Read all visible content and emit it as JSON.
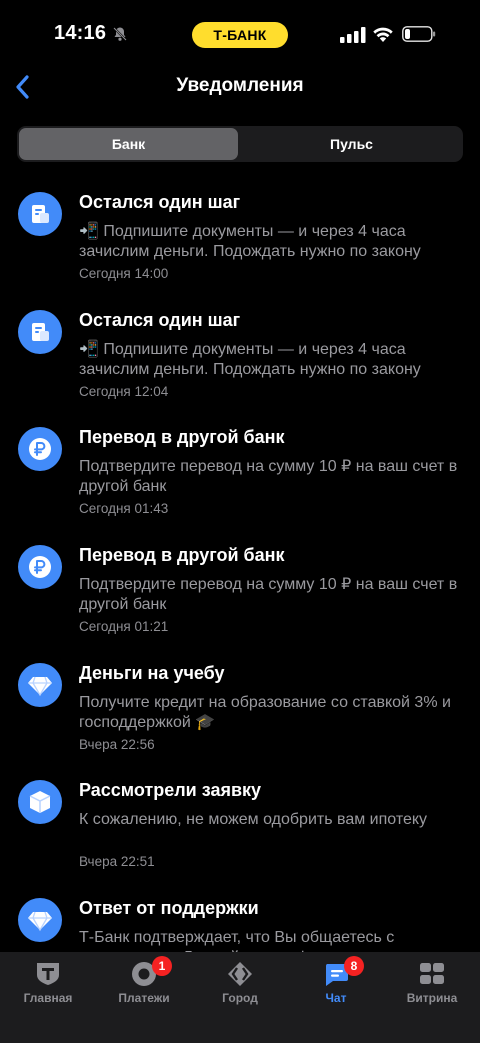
{
  "status_bar": {
    "time": "14:16",
    "brand": "Т-БАНК"
  },
  "header": {
    "title": "Уведомления"
  },
  "segments": [
    {
      "label": "Банк",
      "active": true
    },
    {
      "label": "Пульс",
      "active": false
    }
  ],
  "notifications": [
    {
      "icon": "document-icon",
      "title": "Остался один шаг",
      "body": "📲 Подпишите документы — и через 4 часа зачислим деньги. Подождать нужно по закону",
      "time": "Сегодня 14:00"
    },
    {
      "icon": "document-icon",
      "title": "Остался один шаг",
      "body": "📲 Подпишите документы — и через 4 часа зачислим деньги. Подождать нужно по закону",
      "time": "Сегодня 12:04"
    },
    {
      "icon": "ruble-icon",
      "title": "Перевод в другой банк",
      "body": "Подтвердите перевод на сумму 10 ₽ на ваш счет в другой банк",
      "time": "Сегодня 01:43"
    },
    {
      "icon": "ruble-icon",
      "title": "Перевод в другой банк",
      "body": "Подтвердите перевод на сумму 10 ₽ на ваш счет в другой банк",
      "time": "Сегодня 01:21"
    },
    {
      "icon": "diamond-icon",
      "title": "Деньги на учебу",
      "body": "Получите кредит на образование со ставкой 3% и господдержкой 🎓",
      "time": "Вчера 22:56"
    },
    {
      "icon": "box-icon",
      "title": "Рассмотрели заявку",
      "body": "К сожалению, не можем одобрить вам ипотеку",
      "time": "Вчера 22:51"
    },
    {
      "icon": "diamond-icon",
      "title": "Ответ от поддержки",
      "body": "Т-Банк подтверждает, что Вы общаетесь с сотрудником. Личный идентификатор",
      "time": ""
    }
  ],
  "tabbar": [
    {
      "label": "Главная",
      "icon": "shield-t-icon",
      "badge": ""
    },
    {
      "label": "Платежи",
      "icon": "payments-icon",
      "badge": "1"
    },
    {
      "label": "Город",
      "icon": "city-icon",
      "badge": ""
    },
    {
      "label": "Чат",
      "icon": "chat-icon",
      "badge": "8",
      "active": true
    },
    {
      "label": "Витрина",
      "icon": "showcase-icon",
      "badge": ""
    }
  ],
  "colors": {
    "accent": "#428bf9",
    "brand_yellow": "#ffdd2d",
    "badge_red": "#f52222"
  }
}
